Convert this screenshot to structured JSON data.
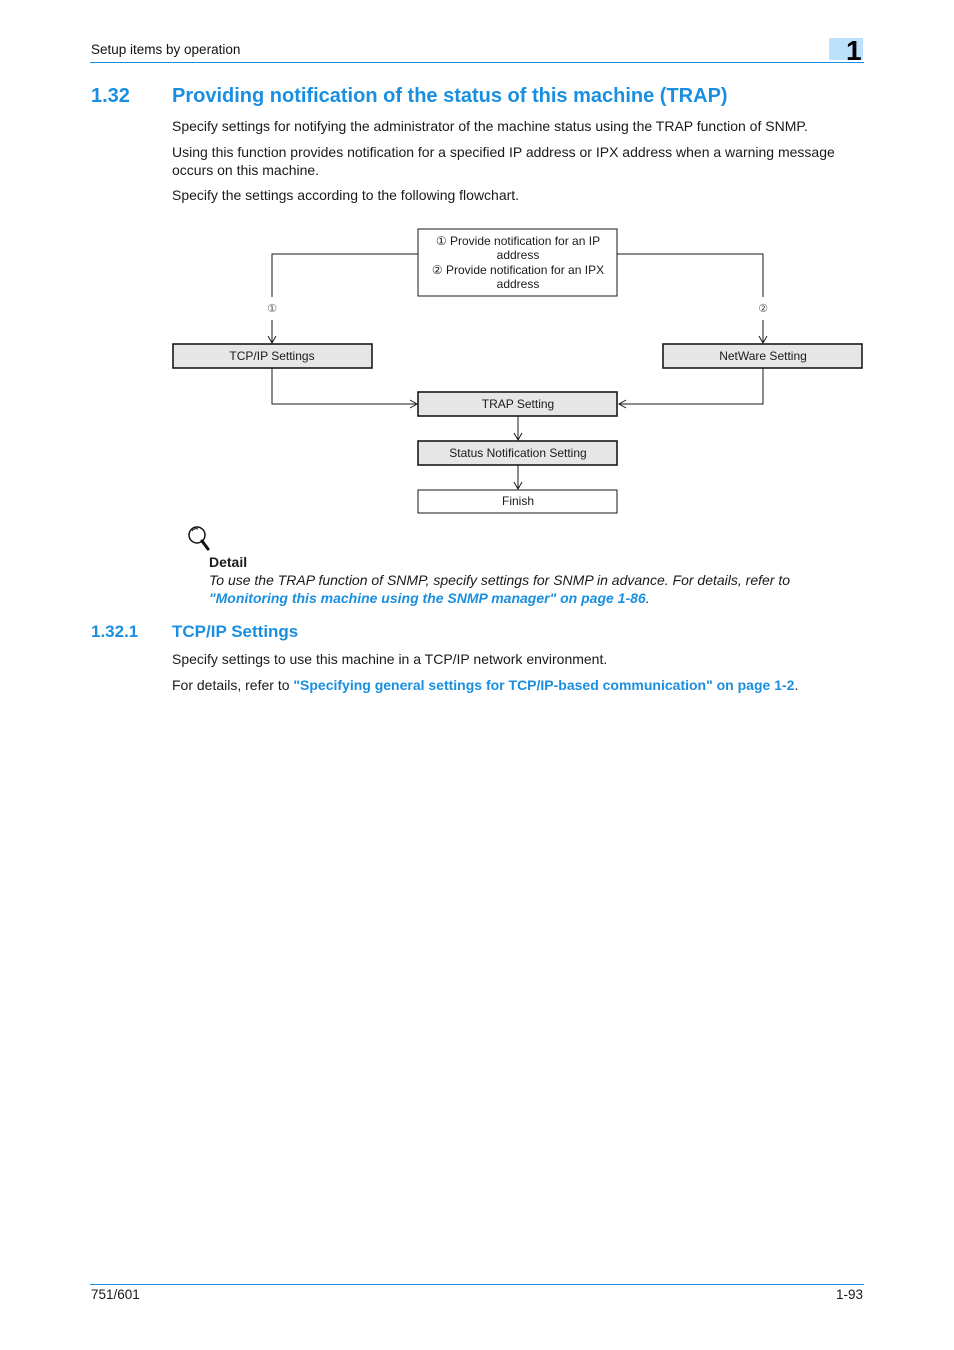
{
  "header": {
    "running_title": "Setup items by operation",
    "chapter_number": "1"
  },
  "section": {
    "number": "1.32",
    "title": "Providing notification of the status of this machine (TRAP)",
    "paragraphs": [
      "Specify settings for notifying the administrator of the machine status using the TRAP function of SNMP.",
      "Using this function provides notification for a specified IP address or IPX address when a warning message occurs on this machine.",
      "Specify the settings according to the following flowchart."
    ]
  },
  "flowchart": {
    "start_box": {
      "line1": "① Provide notification for an IP",
      "line2": "address",
      "line3": "② Provide notification for an IPX",
      "line4": "address"
    },
    "branch_labels": {
      "left": "①",
      "right": "②"
    },
    "tcpip_box": "TCP/IP Settings",
    "netware_box": "NetWare Setting",
    "trap_box": "TRAP Setting",
    "status_box": "Status Notification Setting",
    "finish_box": "Finish"
  },
  "detail": {
    "icon": "magnifier-icon",
    "title": "Detail",
    "body": "To use the TRAP function of SNMP, specify settings for SNMP in advance. For details, refer to",
    "link": "\"Monitoring this machine using the SNMP manager\" on page 1-86",
    "trailing": "."
  },
  "subsection": {
    "number": "1.32.1",
    "title": "TCP/IP Settings",
    "paragraph1": "Specify settings to use this machine in a TCP/IP network environment.",
    "paragraph2_prefix": "For details, refer to ",
    "paragraph2_link": "\"Specifying general settings for TCP/IP-based communication\" on page 1-2",
    "paragraph2_suffix": "."
  },
  "footer": {
    "model": "751/601",
    "page": "1-93"
  },
  "colors": {
    "accent": "#1a8fe0",
    "chapter_tab": "#bde0fb",
    "box_fill": "#e6e6e6"
  }
}
